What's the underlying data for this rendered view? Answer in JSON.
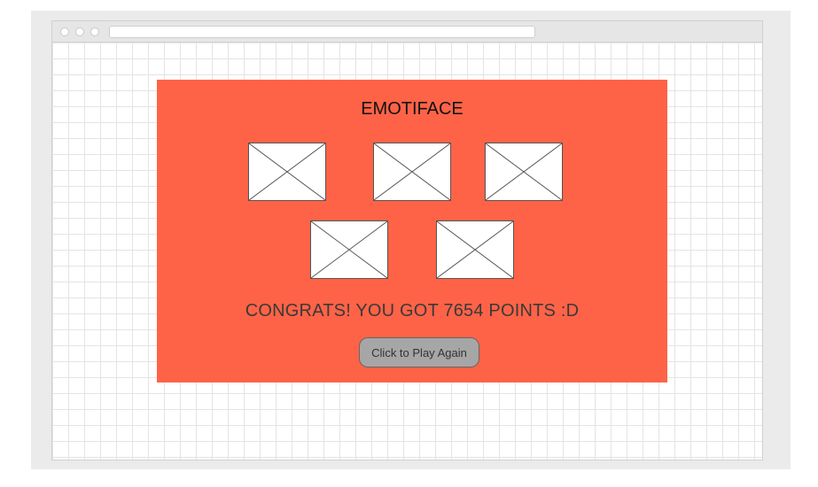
{
  "game": {
    "title": "EMOTIFACE",
    "score_message": "CONGRATS! YOU GOT 7654 POINTS :D",
    "play_again_label": "Click to Play Again",
    "panel_color": "#ff6347"
  },
  "images": [
    {
      "name": "image-placeholder-1"
    },
    {
      "name": "image-placeholder-2"
    },
    {
      "name": "image-placeholder-3"
    },
    {
      "name": "image-placeholder-4"
    },
    {
      "name": "image-placeholder-5"
    }
  ]
}
